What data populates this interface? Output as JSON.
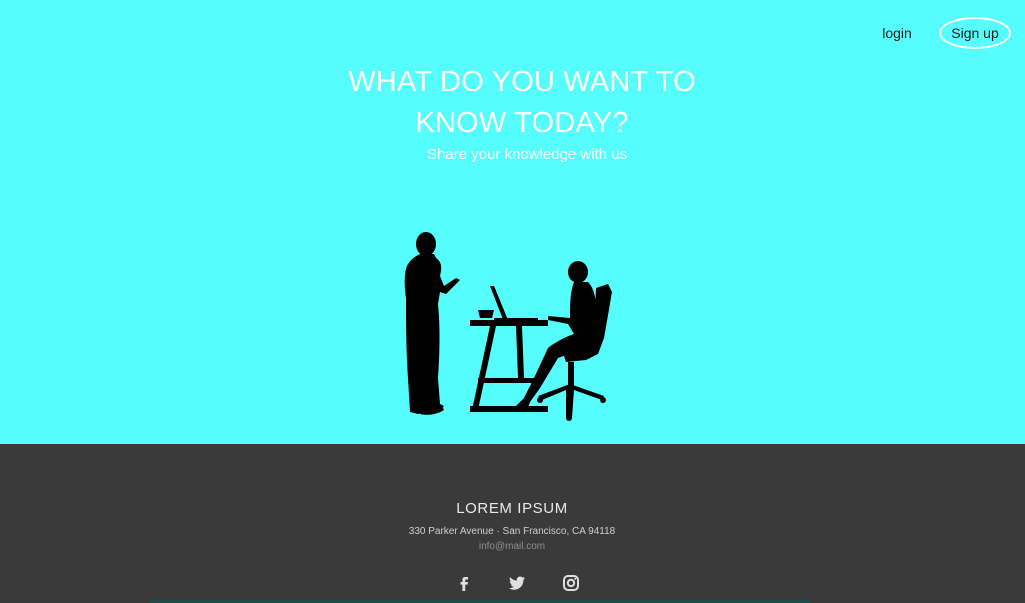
{
  "nav": {
    "login_label": "login",
    "signup_label": "Sign up"
  },
  "hero": {
    "title_line1": "WHAT DO YOU WANT TO",
    "title_line2": "KNOW TODAY?",
    "subtitle": "Share your knowledge with us",
    "illustration_icon": "people-at-desk-illustration"
  },
  "footer": {
    "title": "LOREM IPSUM",
    "address": "330 Parker Avenue · San Francisco, CA 94118",
    "email": "info@mail.com",
    "social": [
      {
        "icon": "facebook-icon"
      },
      {
        "icon": "twitter-icon"
      },
      {
        "icon": "instagram-icon"
      }
    ]
  },
  "colors": {
    "hero_bg": "#55fdfd",
    "footer_bg": "#3a3a3a",
    "text_light": "#ffffff"
  }
}
